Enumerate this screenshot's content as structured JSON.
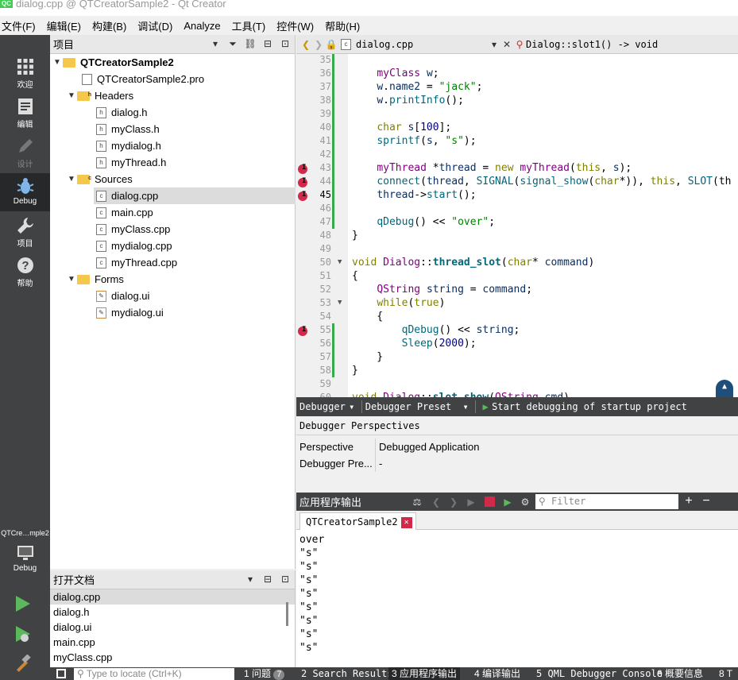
{
  "window": {
    "title": "dialog.cpp @ QTCreatorSample2 - Qt Creator",
    "logo": "QC"
  },
  "menu": [
    "文件(F)",
    "编辑(E)",
    "构建(B)",
    "调试(D)",
    "Analyze",
    "工具(T)",
    "控件(W)",
    "帮助(H)"
  ],
  "modes": {
    "welcome": "欢迎",
    "edit": "编辑",
    "design": "设计",
    "debug": "Debug",
    "projects": "项目",
    "help": "帮助",
    "kit_project": "QTCre…mple2",
    "kit_build": "Debug"
  },
  "project_pane": {
    "title": "项目",
    "tree": {
      "root": "QTCreatorSample2",
      "pro_file": "QTCreatorSample2.pro",
      "headers": "Headers",
      "header_files": [
        "dialog.h",
        "myClass.h",
        "mydialog.h",
        "myThread.h"
      ],
      "sources": "Sources",
      "source_files": [
        "dialog.cpp",
        "main.cpp",
        "myClass.cpp",
        "mydialog.cpp",
        "myThread.cpp"
      ],
      "forms": "Forms",
      "form_files": [
        "dialog.ui",
        "mydialog.ui"
      ]
    }
  },
  "open_docs": {
    "title": "打开文档",
    "items": [
      "dialog.cpp",
      "dialog.h",
      "dialog.ui",
      "main.cpp",
      "myClass.cpp"
    ]
  },
  "editor": {
    "file": "dialog.cpp",
    "symbol": "Dialog::slot1() -> void",
    "line_numbers": [
      "35",
      "36",
      "37",
      "38",
      "39",
      "40",
      "41",
      "42",
      "43",
      "44",
      "45",
      "46",
      "47",
      "48",
      "49",
      "50",
      "51",
      "52",
      "53",
      "54",
      "55",
      "56",
      "57",
      "58",
      "59",
      "60"
    ]
  },
  "debug_toolbar": {
    "debugger": "Debugger",
    "preset": "Debugger Preset",
    "start": "Start debugging of startup project"
  },
  "perspectives": {
    "title": "Debugger Perspectives",
    "rows": [
      {
        "k": "Perspective",
        "v": "Debugged Application"
      },
      {
        "k": "Debugger Pre...",
        "v": "-"
      }
    ]
  },
  "output": {
    "title": "应用程序输出",
    "filter_placeholder": "Filter",
    "tab": "QTCreatorSample2",
    "lines": [
      "over",
      "\"s\"",
      "\"s\"",
      "\"s\"",
      "\"s\"",
      "\"s\"",
      "\"s\"",
      "\"s\"",
      "\"s\""
    ]
  },
  "statusbar": {
    "locate_placeholder": "Type to locate (Ctrl+K)",
    "items": [
      "1 问题",
      "2 Search Results",
      "3 应用程序输出",
      "4 编译输出",
      "5 QML Debugger Console",
      "6 概要信息",
      "8 T"
    ],
    "problems_count": "7"
  },
  "colors": {
    "keyword": "#808000",
    "type": "#800080",
    "string": "#008000",
    "function": "#00677c",
    "breakpoint": "#d2284a",
    "sidebar": "#404244"
  }
}
